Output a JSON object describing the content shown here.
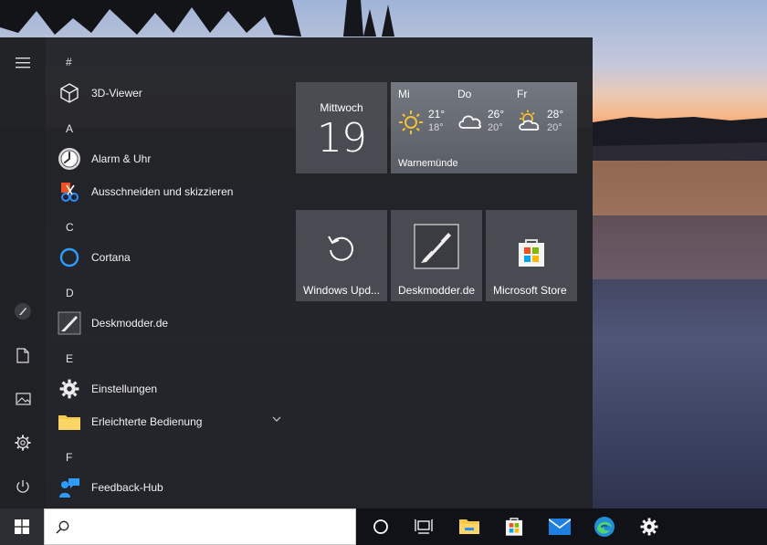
{
  "menu": {
    "hamburger_icon": "hamburger-icon"
  },
  "rail": {
    "items": [
      {
        "name": "deskmodder-small-icon"
      },
      {
        "name": "documents-icon"
      },
      {
        "name": "pictures-icon"
      },
      {
        "name": "settings-gear-icon"
      },
      {
        "name": "power-icon"
      }
    ]
  },
  "app_list": {
    "groups": [
      {
        "letter": "#",
        "apps": [
          {
            "label": "3D-Viewer",
            "icon": "cube-icon"
          }
        ]
      },
      {
        "letter": "A",
        "apps": [
          {
            "label": "Alarm & Uhr",
            "icon": "clock-icon"
          },
          {
            "label": "Ausschneiden und skizzieren",
            "icon": "snip-icon"
          }
        ]
      },
      {
        "letter": "C",
        "apps": [
          {
            "label": "Cortana",
            "icon": "cortana-ring-icon"
          }
        ]
      },
      {
        "letter": "D",
        "apps": [
          {
            "label": "Deskmodder.de",
            "icon": "brush-icon"
          }
        ]
      },
      {
        "letter": "E",
        "apps": [
          {
            "label": "Einstellungen",
            "icon": "gear-icon"
          },
          {
            "label": "Erleichterte Bedienung",
            "icon": "folder-icon",
            "expandable": true
          }
        ]
      },
      {
        "letter": "F",
        "apps": [
          {
            "label": "Feedback-Hub",
            "icon": "feedback-person-icon"
          }
        ]
      }
    ]
  },
  "tiles": {
    "calendar": {
      "day": "Mittwoch",
      "date": "19"
    },
    "weather": {
      "days": [
        {
          "name": "Mi",
          "hi": "21°",
          "lo": "18°",
          "icon": "sun-icon"
        },
        {
          "name": "Do",
          "hi": "26°",
          "lo": "20°",
          "icon": "cloud-icon"
        },
        {
          "name": "Fr",
          "hi": "28°",
          "lo": "20°",
          "icon": "partly-cloudy-icon"
        }
      ],
      "city": "Warnemünde"
    },
    "windows_update": {
      "label": "Windows Upd...",
      "icon": "refresh-icon"
    },
    "deskmodder": {
      "label": "Deskmodder.de",
      "icon": "brush-icon"
    },
    "store": {
      "label": "Microsoft Store",
      "icon": "store-bag-icon"
    }
  },
  "taskbar": {
    "search_placeholder": "",
    "items": [
      {
        "name": "cortana-circle-icon"
      },
      {
        "name": "task-view-icon"
      },
      {
        "name": "file-explorer-icon"
      },
      {
        "name": "store-icon"
      },
      {
        "name": "mail-icon"
      },
      {
        "name": "edge-icon"
      },
      {
        "name": "settings-icon"
      }
    ]
  },
  "colors": {
    "accent_blue": "#2d8cff",
    "weather_sun": "#f6c233",
    "folder_yellow": "#f7c84a"
  }
}
